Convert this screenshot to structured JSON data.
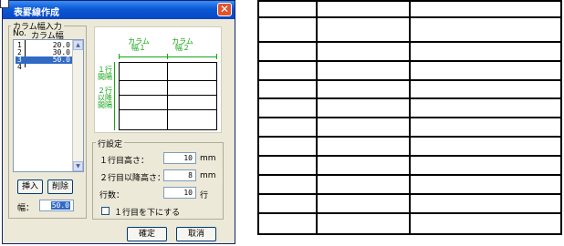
{
  "dialog": {
    "title": "表罫線作成",
    "close_glyph": "✕",
    "column_input": {
      "group_label": "カラム幅入力",
      "header_no": "No.",
      "header_width": "カラム幅",
      "rows": [
        {
          "no": "1",
          "value": "20.0"
        },
        {
          "no": "2",
          "value": "30.0"
        },
        {
          "no": "3",
          "value": "50.0",
          "selected": true
        },
        {
          "no": "4",
          "value": ""
        }
      ],
      "scroll_up": "▲",
      "scroll_down": "▼",
      "insert_label": "挿入",
      "delete_label": "削除",
      "width_label": "幅：",
      "width_value": "50.0"
    },
    "preview": {
      "col1_label_1": "カラム",
      "col1_label_2": "幅１",
      "col2_label_1": "カラム",
      "col2_label_2": "幅２",
      "row1_label_1": "１行",
      "row1_label_2": "間隔",
      "row2_label_1": "２行",
      "row2_label_2": "以降",
      "row2_label_3": "間隔"
    },
    "row_settings": {
      "group_label": "行設定",
      "first_row_height_label": "１行目高さ：",
      "first_row_height_value": "10",
      "first_row_height_unit": "mm",
      "other_row_height_label": "２行目以降高さ：",
      "other_row_height_value": "8",
      "other_row_height_unit": "mm",
      "row_count_label": "行数：",
      "row_count_value": "10",
      "row_count_unit": "行",
      "first_row_bottom_label": "１行目を下にする",
      "first_row_bottom_checked": false
    },
    "ok_label": "確定",
    "cancel_label": "取消"
  },
  "colors": {
    "title_bar": "#0b58d4",
    "selection": "#316ac5",
    "green": "#14a514",
    "dialog_bg": "#ece9d8"
  }
}
